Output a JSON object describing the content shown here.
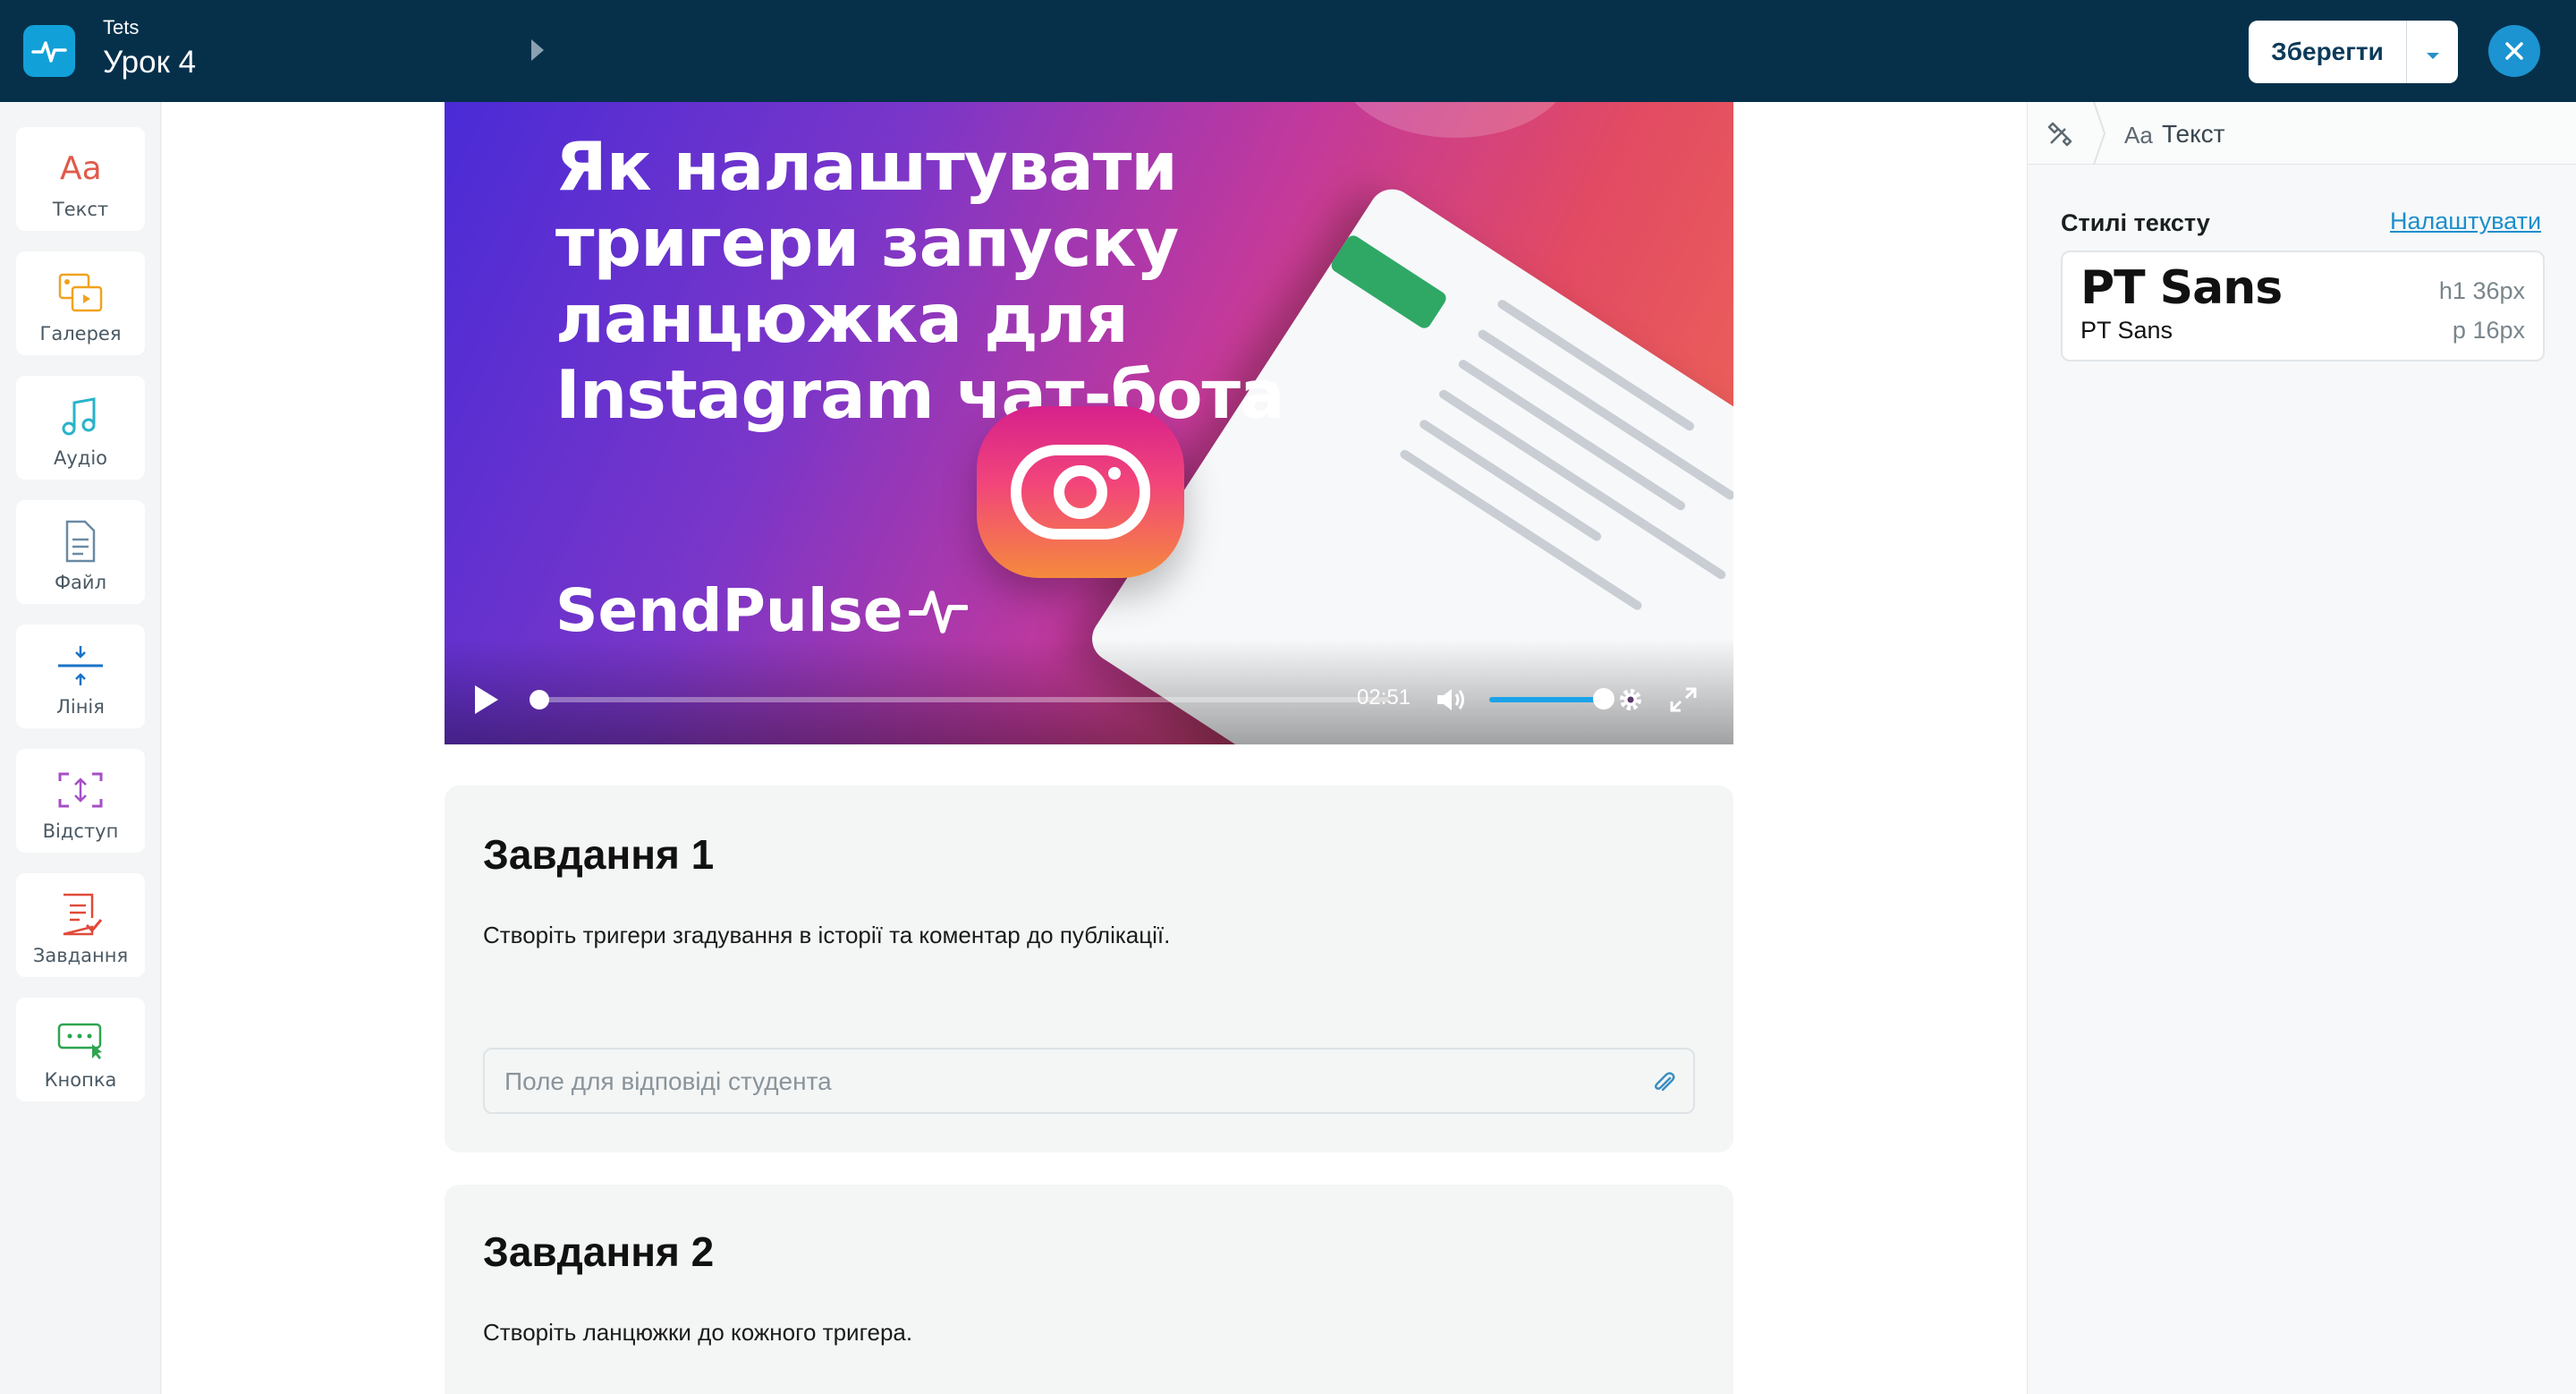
{
  "header": {
    "course_name": "Tets",
    "lesson_title": "Урок 4",
    "save_label": "Зберегти",
    "logo_icon": "pulse-icon",
    "close_icon": "close-icon",
    "accent": "#1b94d1",
    "bg": "#06304a"
  },
  "tools": [
    {
      "label": "Текст",
      "icon": "text-aa-icon",
      "color": "#e05a4a"
    },
    {
      "label": "Галерея",
      "icon": "gallery-icon",
      "color": "#f0a21f"
    },
    {
      "label": "Аудіо",
      "icon": "audio-icon",
      "color": "#29b3c9"
    },
    {
      "label": "Файл",
      "icon": "file-icon",
      "color": "#6a8aa3"
    },
    {
      "label": "Лінія",
      "icon": "line-icon",
      "color": "#1a73c7"
    },
    {
      "label": "Відступ",
      "icon": "spacing-icon",
      "color": "#a64fc7"
    },
    {
      "label": "Завдання",
      "icon": "task-icon",
      "color": "#e04a3a"
    },
    {
      "label": "Кнопка",
      "icon": "button-icon",
      "color": "#2ea44f"
    }
  ],
  "video": {
    "title": "Як налаштувати тригери запуску ланцюжка для Instagram чат-бота",
    "brand": "SendPulse",
    "time": "02:51",
    "progress": 0.01,
    "volume": 1.0
  },
  "tasks": [
    {
      "title": "Завдання 1",
      "text": "Створіть тригери згадування в історії та коментар до публікації.",
      "answer_placeholder": "Поле для відповіді студента"
    },
    {
      "title": "Завдання 2",
      "text": "Створіть ланцюжки до кожного тригера."
    }
  ],
  "right_panel": {
    "breadcrumb_prefix": "Aa",
    "breadcrumb_label": "Текст",
    "styles_heading": "Стилі тексту",
    "styles_link": "Налаштувати",
    "font_h1": "PT Sans",
    "font_p": "PT Sans",
    "h1_meta": "h1  36px",
    "p_meta": "p  16px"
  }
}
